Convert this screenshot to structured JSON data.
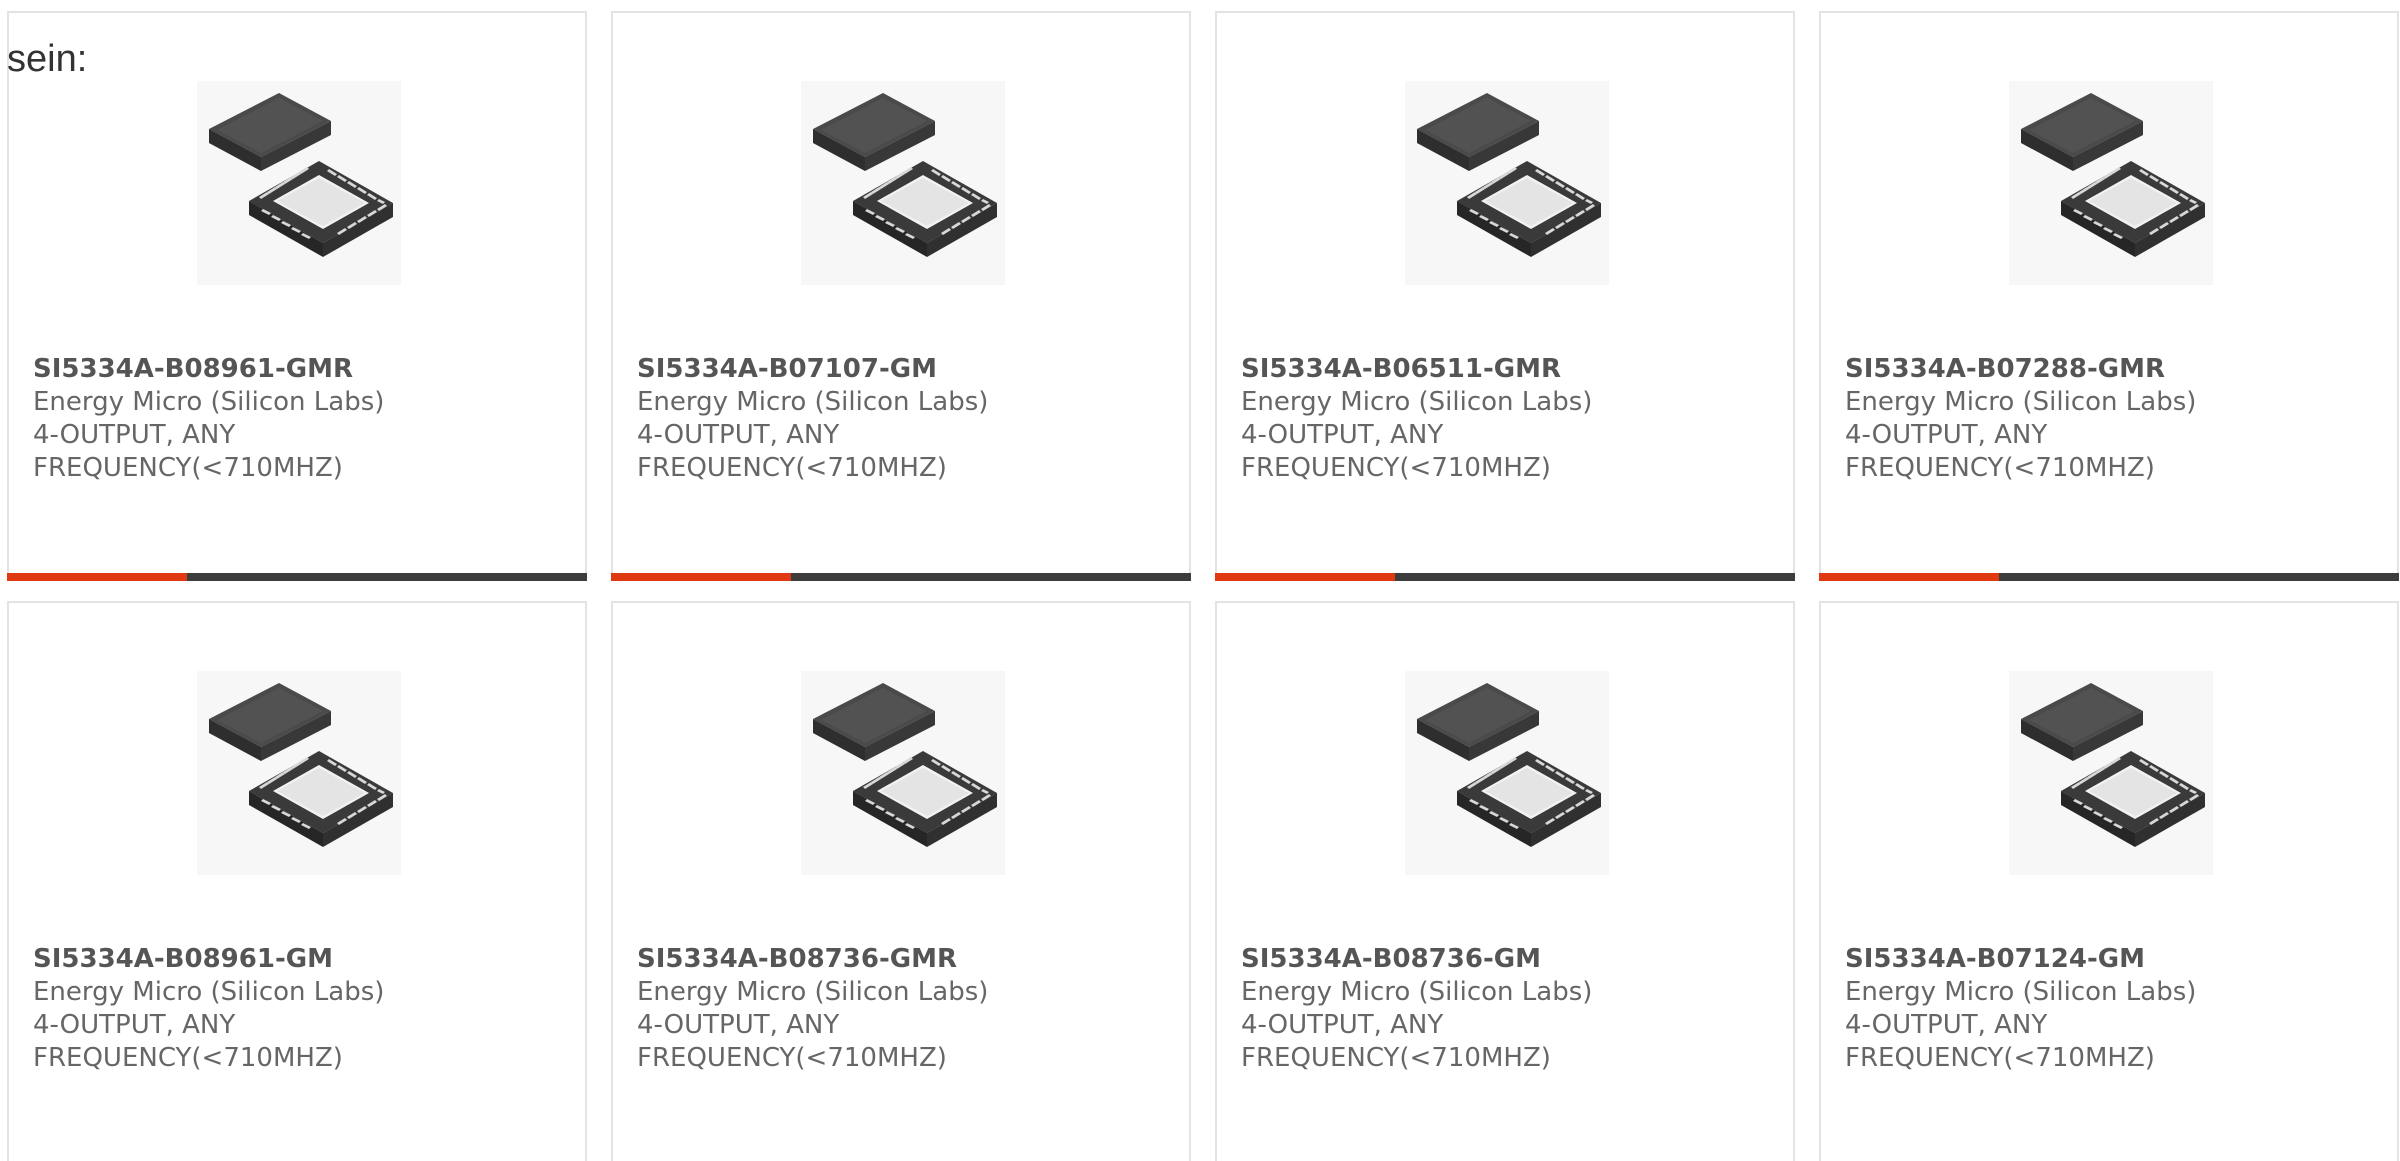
{
  "page": {
    "intro_text": "sein:"
  },
  "colors": {
    "accent": "#e03a12",
    "track": "#3d3d3d",
    "card_border": "#e3e3e3",
    "text_muted": "#666666"
  },
  "products": [
    {
      "part_number": "SI5334A-B08961-GMR",
      "manufacturer": "Energy Micro (Silicon Labs)",
      "description_line1": "4-OUTPUT, ANY",
      "description_line2": "FREQUENCY(<710MHZ)",
      "image_icon": "qfn-chip-icon",
      "progress": 0.31
    },
    {
      "part_number": "SI5334A-B07107-GM",
      "manufacturer": "Energy Micro (Silicon Labs)",
      "description_line1": "4-OUTPUT, ANY",
      "description_line2": "FREQUENCY(<710MHZ)",
      "image_icon": "qfn-chip-icon",
      "progress": 0.31
    },
    {
      "part_number": "SI5334A-B06511-GMR",
      "manufacturer": "Energy Micro (Silicon Labs)",
      "description_line1": "4-OUTPUT, ANY",
      "description_line2": "FREQUENCY(<710MHZ)",
      "image_icon": "qfn-chip-icon",
      "progress": 0.31
    },
    {
      "part_number": "SI5334A-B07288-GMR",
      "manufacturer": "Energy Micro (Silicon Labs)",
      "description_line1": "4-OUTPUT, ANY",
      "description_line2": "FREQUENCY(<710MHZ)",
      "image_icon": "qfn-chip-icon",
      "progress": 0.31
    },
    {
      "part_number": "SI5334A-B08961-GM",
      "manufacturer": "Energy Micro (Silicon Labs)",
      "description_line1": "4-OUTPUT, ANY",
      "description_line2": "FREQUENCY(<710MHZ)",
      "image_icon": "qfn-chip-icon",
      "progress": null
    },
    {
      "part_number": "SI5334A-B08736-GMR",
      "manufacturer": "Energy Micro (Silicon Labs)",
      "description_line1": "4-OUTPUT, ANY",
      "description_line2": "FREQUENCY(<710MHZ)",
      "image_icon": "qfn-chip-icon",
      "progress": null
    },
    {
      "part_number": "SI5334A-B08736-GM",
      "manufacturer": "Energy Micro (Silicon Labs)",
      "description_line1": "4-OUTPUT, ANY",
      "description_line2": "FREQUENCY(<710MHZ)",
      "image_icon": "qfn-chip-icon",
      "progress": null
    },
    {
      "part_number": "SI5334A-B07124-GM",
      "manufacturer": "Energy Micro (Silicon Labs)",
      "description_line1": "4-OUTPUT, ANY",
      "description_line2": "FREQUENCY(<710MHZ)",
      "image_icon": "qfn-chip-icon",
      "progress": null
    }
  ]
}
